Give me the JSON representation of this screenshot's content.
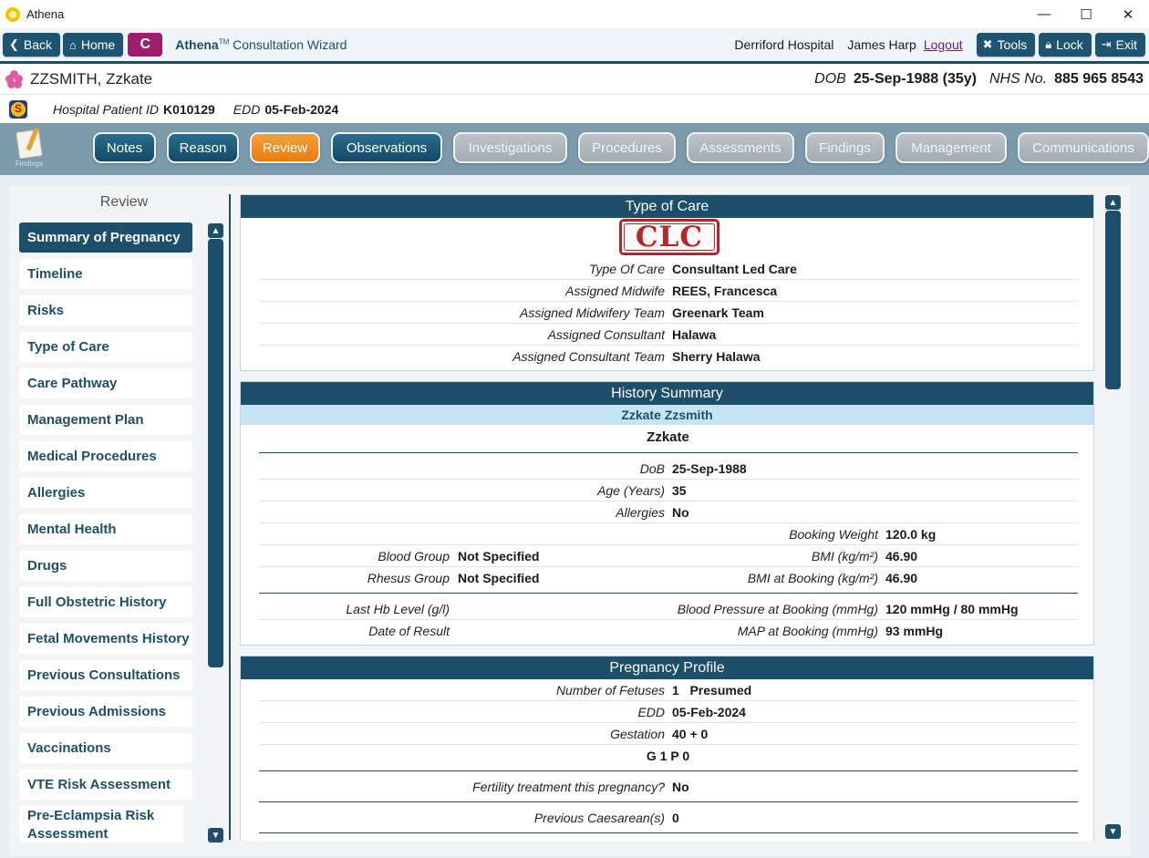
{
  "window": {
    "title": "Athena",
    "minimize": "—",
    "maximize": "☐",
    "close": "✕"
  },
  "toolbar": {
    "back": "Back",
    "home": "Home",
    "c_label": "C",
    "wizard_brand": "Athena",
    "wizard_tm": "TM",
    "wizard_title": "Consultation Wizard",
    "hospital": "Derriford Hospital",
    "user": "James Harp",
    "logout": "Logout",
    "tools": "Tools",
    "lock": "Lock",
    "exit": "Exit"
  },
  "patient": {
    "name": "ZZSMITH, Zzkate",
    "dob_label": "DOB",
    "dob_value": "25-Sep-1988 (35y)",
    "nhs_label": "NHS No.",
    "nhs_value": "885 965 8543",
    "hpid_label": "Hospital Patient ID",
    "hpid_value": "K010129",
    "edd_label": "EDD",
    "edd_value": "05-Feb-2024"
  },
  "tabs": {
    "findings_caption": "Findings",
    "items": [
      {
        "label": "Notes",
        "state": "active"
      },
      {
        "label": "Reason",
        "state": "active"
      },
      {
        "label": "Review",
        "state": "current"
      },
      {
        "label": "Observations",
        "state": "active"
      },
      {
        "label": "Investigations",
        "state": "disabled"
      },
      {
        "label": "Procedures",
        "state": "disabled"
      },
      {
        "label": "Assessments",
        "state": "disabled"
      },
      {
        "label": "Findings",
        "state": "disabled"
      },
      {
        "label": "Management",
        "state": "disabled"
      },
      {
        "label": "Communications",
        "state": "disabled"
      }
    ]
  },
  "sidebar": {
    "title": "Review",
    "items": [
      "Summary of Pregnancy",
      "Timeline",
      "Risks",
      "Type of Care",
      "Care Pathway",
      "Management Plan",
      "Medical Procedures",
      "Allergies",
      "Mental Health",
      "Drugs",
      "Full Obstetric History",
      "Fetal Movements History",
      "Previous Consultations",
      "Previous Admissions",
      "Vaccinations",
      "VTE Risk Assessment",
      "Pre-Eclampsia Risk Assessment"
    ],
    "selected": "Summary of Pregnancy"
  },
  "type_of_care": {
    "title": "Type of Care",
    "stamp": "CLC",
    "rows": [
      {
        "label": "Type Of Care",
        "value": "Consultant Led Care"
      },
      {
        "label": "Assigned Midwife",
        "value": "REES, Francesca"
      },
      {
        "label": "Assigned Midwifery Team",
        "value": "Greenark Team"
      },
      {
        "label": "Assigned Consultant",
        "value": "Halawa"
      },
      {
        "label": "Assigned Consultant Team",
        "value": "Sherry Halawa"
      }
    ]
  },
  "history": {
    "title": "History Summary",
    "fullname": "Zzkate Zzsmith",
    "firstname": "Zzkate",
    "dob_label": "DoB",
    "dob_value": "25-Sep-1988",
    "age_label": "Age (Years)",
    "age_value": "35",
    "allergies_label": "Allergies",
    "allergies_value": "No",
    "booking_weight_label": "Booking Weight",
    "booking_weight_value": "120.0 kg",
    "blood_group_label": "Blood Group",
    "blood_group_value": "Not Specified",
    "bmi_label": "BMI (kg/m²)",
    "bmi_value": "46.90",
    "rhesus_label": "Rhesus Group",
    "rhesus_value": "Not Specified",
    "bmi_booking_label": "BMI at Booking (kg/m²)",
    "bmi_booking_value": "46.90",
    "hb_label": "Last Hb Level (g/l)",
    "bp_label": "Blood Pressure at Booking (mmHg)",
    "bp_value": "120 mmHg / 80 mmHg",
    "result_date_label": "Date of Result",
    "map_label": "MAP at Booking (mmHg)",
    "map_value": "93 mmHg"
  },
  "pregnancy": {
    "title": "Pregnancy Profile",
    "fetuses_label": "Number of Fetuses",
    "fetuses_value": "1",
    "fetuses_note": "Presumed",
    "edd_label": "EDD",
    "edd_value": "05-Feb-2024",
    "gestation_label": "Gestation",
    "gestation_value": "40 + 0",
    "gp": "G 1 P 0",
    "fertility_label": "Fertility treatment this pregnancy?",
    "fertility_value": "No",
    "caesarean_label": "Previous Caesarean(s)",
    "caesarean_value": "0"
  }
}
